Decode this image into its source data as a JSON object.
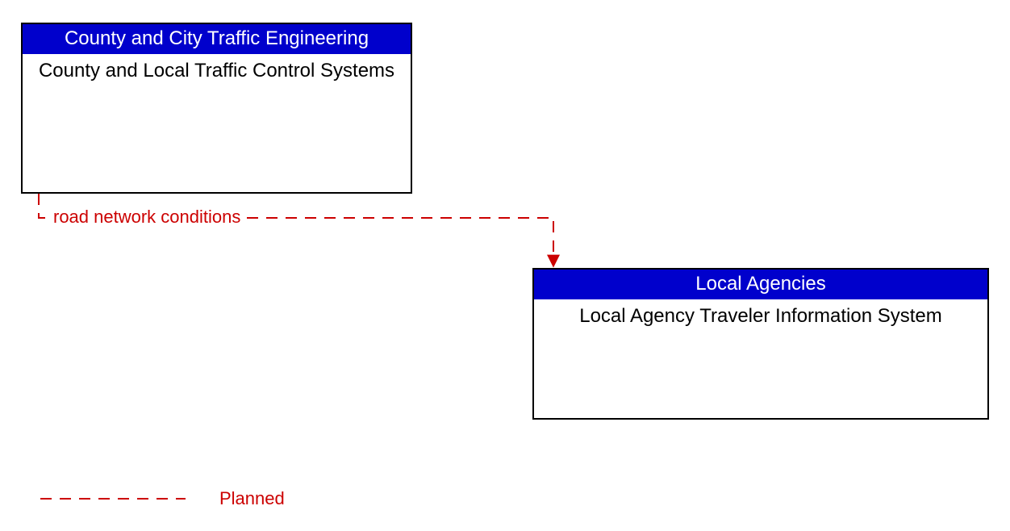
{
  "boxes": {
    "a": {
      "header": "County and City Traffic Engineering",
      "body": "County and Local Traffic Control Systems"
    },
    "b": {
      "header": "Local Agencies",
      "body": "Local Agency Traveler Information System"
    }
  },
  "flows": {
    "ab": "road network conditions"
  },
  "legend": {
    "planned": "Planned"
  },
  "colors": {
    "header_bg": "#0000cc",
    "planned_line": "#cc0000"
  }
}
